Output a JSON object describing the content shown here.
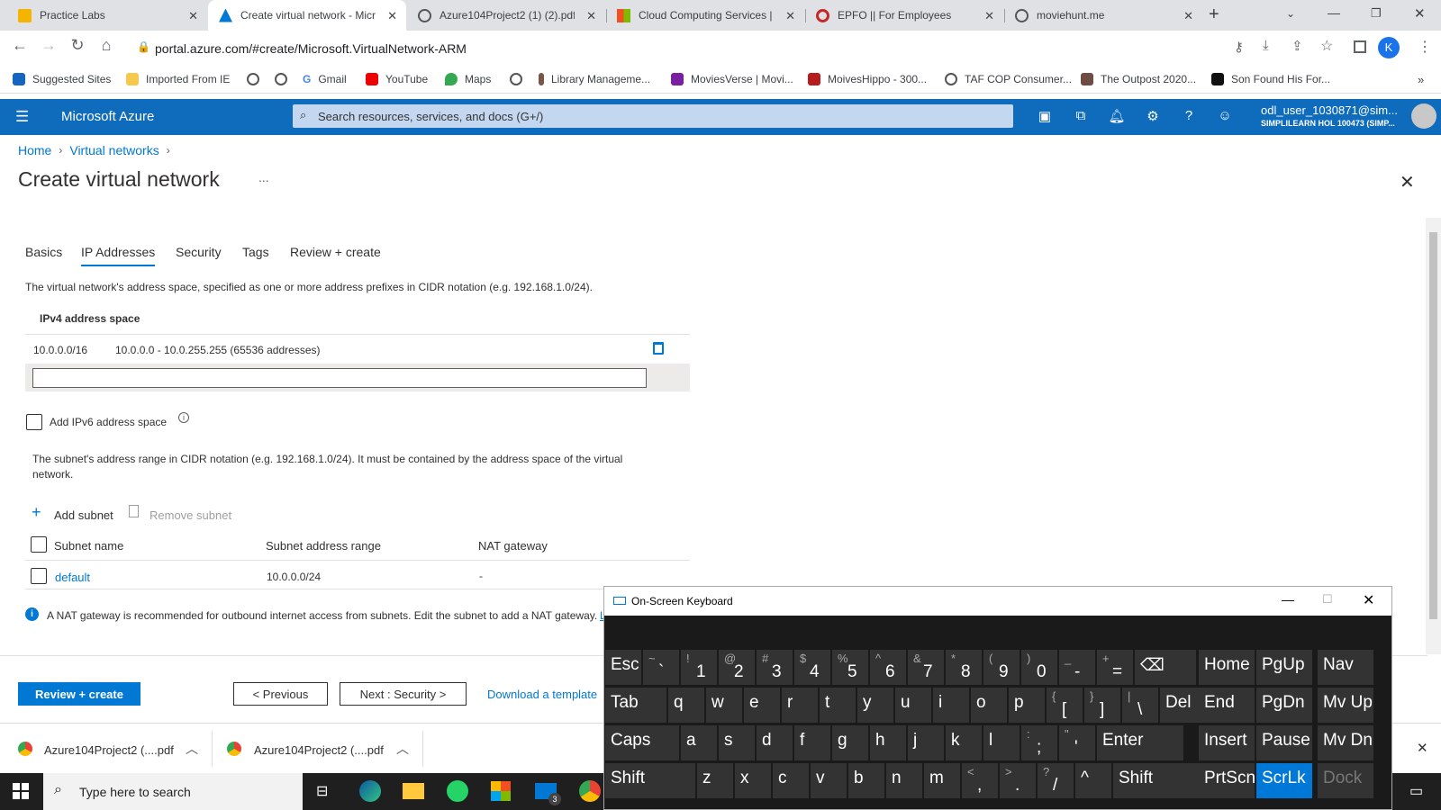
{
  "browser": {
    "tabs": [
      {
        "title": "Practice Labs"
      },
      {
        "title": "Create virtual network - Micro"
      },
      {
        "title": "Azure104Project2 (1) (2).pdf"
      },
      {
        "title": "Cloud Computing Services | M"
      },
      {
        "title": "EPFO || For Employees"
      },
      {
        "title": "moviehunt.me"
      }
    ],
    "url": "portal.azure.com/#create/Microsoft.VirtualNetwork-ARM",
    "profile_initial": "K",
    "bookmarks": [
      "Suggested Sites",
      "Imported From IE",
      "Gmail",
      "YouTube",
      "Maps",
      "Library Manageme...",
      "MoviesVerse | Movi...",
      "MoivesHippo - 300...",
      "TAF COP Consumer...",
      "The Outpost 2020...",
      "Son Found His For..."
    ]
  },
  "azure": {
    "brand": "Microsoft Azure",
    "search_placeholder": "Search resources, services, and docs (G+/)",
    "user_name": "odl_user_1030871@sim...",
    "user_org": "SIMPLILEARN HOL 100473 (SIMP..."
  },
  "breadcrumb": [
    "Home",
    "Virtual networks"
  ],
  "page": {
    "title": "Create virtual network",
    "more": "...",
    "tabs": [
      "Basics",
      "IP Addresses",
      "Security",
      "Tags",
      "Review + create"
    ],
    "active_tab": "IP Addresses",
    "address_desc": "The virtual network's address space, specified as one or more address prefixes in CIDR notation (e.g. 192.168.1.0/24).",
    "ipv4_header": "IPv4 address space",
    "address_prefix": "10.0.0.0/16",
    "address_range": "10.0.0.0 - 10.0.255.255 (65536 addresses)",
    "new_address_value": "",
    "ipv6_label": "Add IPv6 address space",
    "subnet_desc": "The subnet's address range in CIDR notation (e.g. 192.168.1.0/24). It must be contained by the address space of the virtual network.",
    "add_subnet": "Add subnet",
    "remove_subnet": "Remove subnet",
    "columns": [
      "Subnet name",
      "Subnet address range",
      "NAT gateway"
    ],
    "rows": [
      {
        "name": "default",
        "range": "10.0.0.0/24",
        "nat": "-"
      }
    ],
    "nat_info": "A NAT gateway is recommended for outbound internet access from subnets. Edit the subnet to add a NAT gateway.",
    "nat_link": "L",
    "review_btn": "Review + create",
    "prev_btn": "< Previous",
    "next_btn": "Next : Security >",
    "download_link": "Download a template"
  },
  "downloads": [
    {
      "name": "Azure104Project2 (....pdf"
    },
    {
      "name": "Azure104Project2 (....pdf"
    }
  ],
  "taskbar": {
    "search_placeholder": "Type here to search",
    "mail_badge": "3"
  },
  "osk": {
    "title": "On-Screen Keyboard",
    "row1": [
      [
        "Esc",
        ""
      ],
      [
        "`",
        "~"
      ],
      [
        "1",
        "!"
      ],
      [
        "2",
        "@"
      ],
      [
        "3",
        "#"
      ],
      [
        "4",
        "$"
      ],
      [
        "5",
        "%"
      ],
      [
        "6",
        "^"
      ],
      [
        "7",
        "&"
      ],
      [
        "8",
        "*"
      ],
      [
        "9",
        "("
      ],
      [
        "0",
        ")"
      ],
      [
        "-",
        "_"
      ],
      [
        "=",
        "+"
      ],
      [
        "⌫",
        ""
      ]
    ],
    "row2": [
      "Tab",
      "q",
      "w",
      "e",
      "r",
      "t",
      "y",
      "u",
      "i",
      "o",
      "p"
    ],
    "row2b": [
      [
        "[",
        "{"
      ],
      [
        "]",
        "}"
      ],
      [
        "\\",
        "|"
      ],
      [
        "Del",
        ""
      ]
    ],
    "row3": [
      "Caps",
      "a",
      "s",
      "d",
      "f",
      "g",
      "h",
      "j",
      "k",
      "l"
    ],
    "row3b": [
      [
        ";",
        ":"
      ],
      [
        "'",
        "\""
      ],
      [
        "Enter",
        ""
      ]
    ],
    "row4": [
      "Shift",
      "z",
      "x",
      "c",
      "v",
      "b",
      "n",
      "m"
    ],
    "row4b": [
      [
        ",",
        "<"
      ],
      [
        ".",
        ">"
      ],
      [
        "/",
        "?"
      ],
      [
        "^",
        ""
      ],
      [
        "Shift",
        ""
      ]
    ],
    "nav": [
      "Home",
      "PgUp",
      "Nav",
      "End",
      "PgDn",
      "Mv Up",
      "Insert",
      "Pause",
      "Mv Dn",
      "PrtScn",
      "ScrLk",
      "Dock"
    ]
  }
}
